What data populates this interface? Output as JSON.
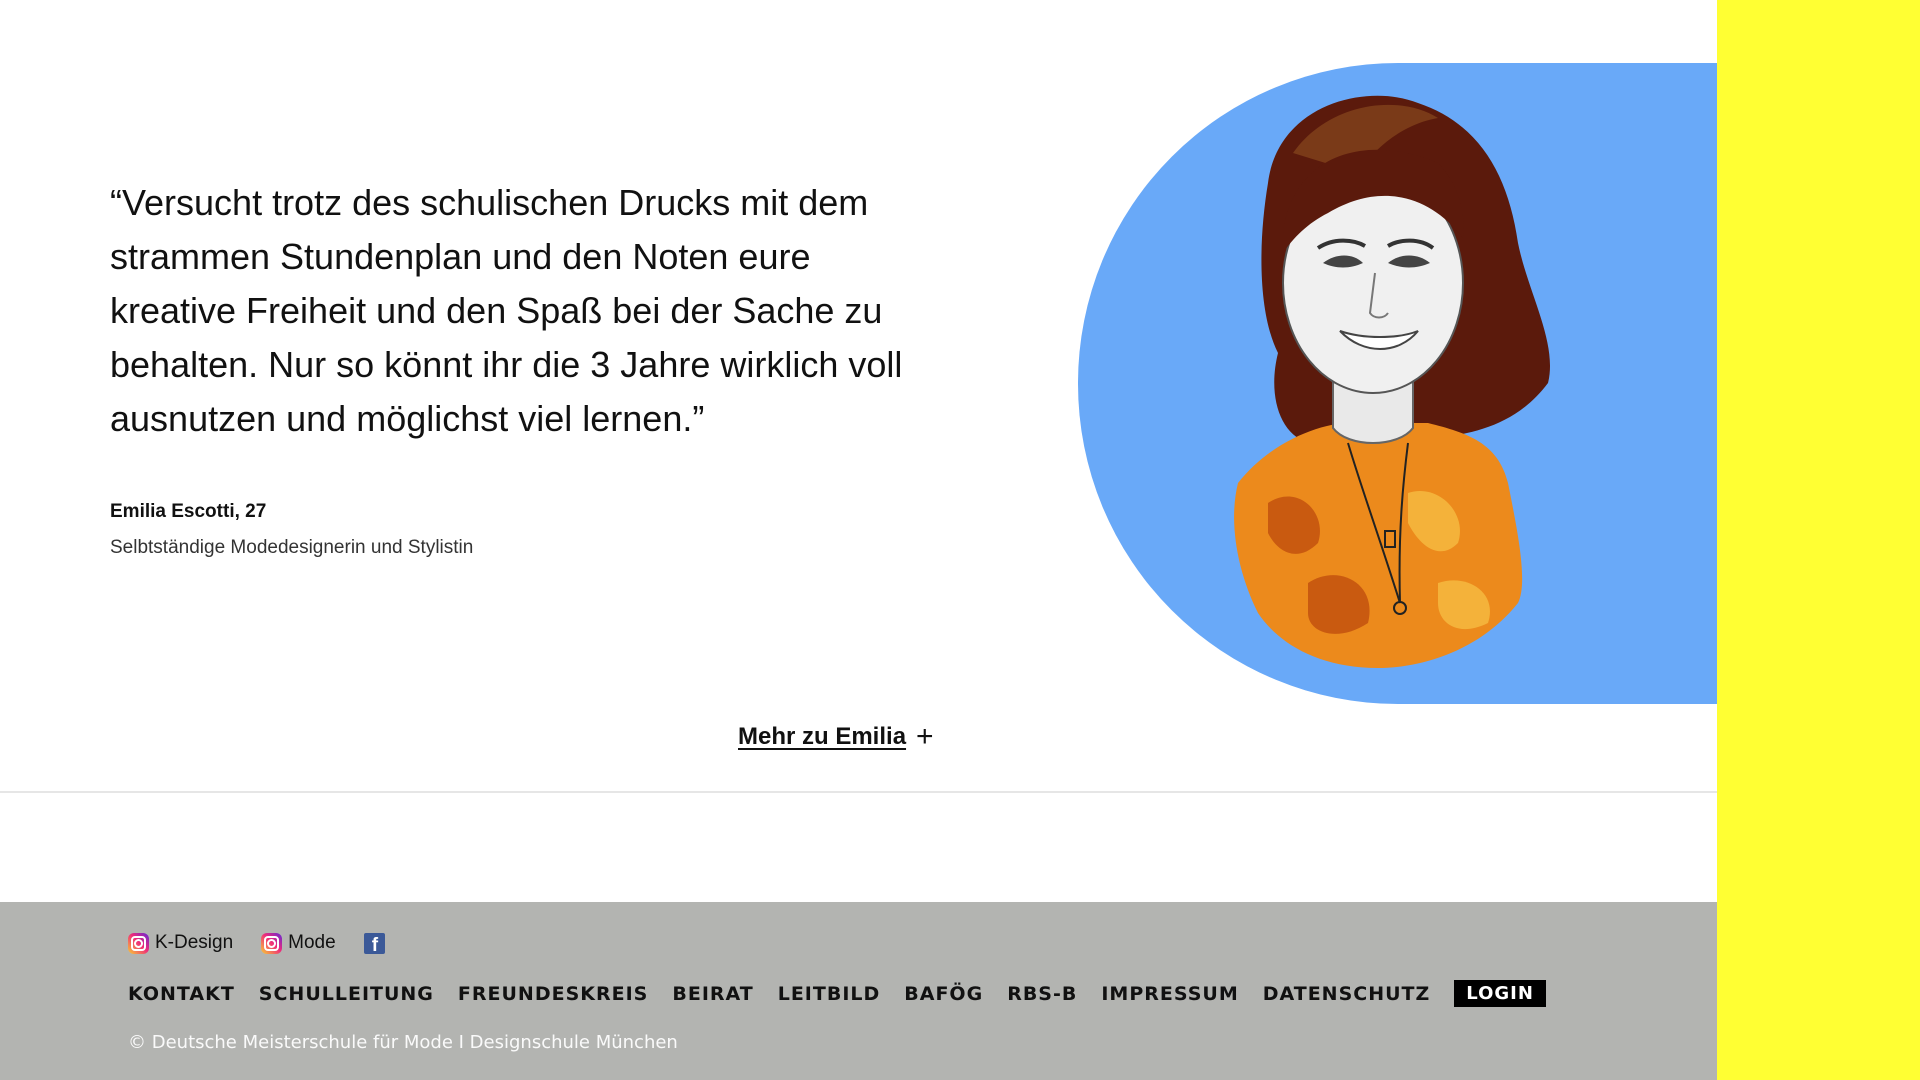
{
  "testimonial": {
    "quote": "“Versucht trotz des schulischen Drucks mit dem strammen Stundenplan und den Noten eure kreative Freiheit und den Spaß bei der Sache zu behalten. Nur so könnt ihr die 3 Jahre wirklich voll ausnutzen und möglichst viel lernen.”",
    "author_name": "Emilia Escotti, 27",
    "author_role": "Selbtständige Modedesignerin und Stylistin",
    "more_label": "Mehr zu Emilia",
    "more_icon": "plus-icon"
  },
  "colors": {
    "accent_yellow": "#ffff33",
    "portrait_blue": "#69a9f8",
    "footer_gray": "#b3b4b1"
  },
  "footer": {
    "social": [
      {
        "icon": "instagram-icon",
        "label": "K-Design"
      },
      {
        "icon": "instagram-icon",
        "label": "Mode"
      },
      {
        "icon": "facebook-icon",
        "label": ""
      }
    ],
    "nav": [
      "KONTAKT",
      "SCHULLEITUNG",
      "FREUNDESKREIS",
      "BEIRAT",
      "LEITBILD",
      "BAFÖG",
      "RBS-B",
      "IMPRESSUM",
      "DATENSCHUTZ"
    ],
    "login_label": "LOGIN",
    "copyright": "© Deutsche Meisterschule für Mode I Designschule München"
  }
}
